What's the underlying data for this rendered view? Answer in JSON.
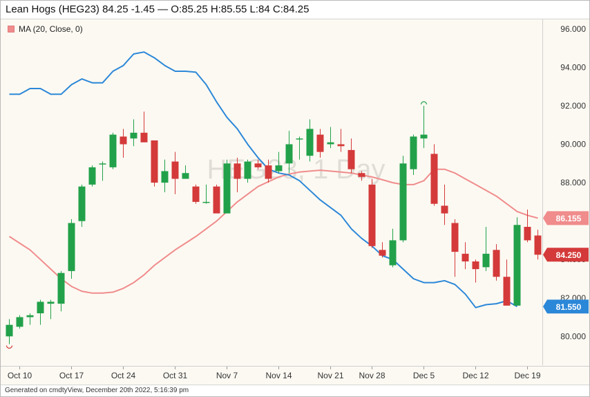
{
  "header": {
    "title": "Lean Hogs (HEG23) 84.25 -1.45 — O:85.25 H:85.55 L:84 C:84.25"
  },
  "footer": {
    "text": "Generated on cmdtyView, December 20th 2022, 5:16:39 pm"
  },
  "legend": {
    "label": "MA (20, Close, 0)"
  },
  "watermark": "HEG23, 1 Day",
  "colors": {
    "up": "#22a14a",
    "down": "#d43a3a",
    "ma": "#f08c8c",
    "band": "#2b87d8",
    "background": "#fcf9f2"
  },
  "chart_data": {
    "type": "candlestick",
    "title": "Lean Hogs (HEG23)",
    "interval": "1 Day",
    "xlabel": "",
    "ylabel": "",
    "ylim": [
      78.5,
      96.5
    ],
    "y_ticks": [
      "80.000",
      "82.000",
      "84.000",
      "86.000",
      "88.000",
      "90.000",
      "92.000",
      "94.000",
      "96.000"
    ],
    "x_tick_labels": [
      "Oct 10",
      "Oct 17",
      "Oct 24",
      "Oct 31",
      "Nov 7",
      "Nov 14",
      "Nov 21",
      "Nov 28",
      "Dec 5",
      "Dec 12",
      "Dec 19"
    ],
    "x_tick_index": [
      1,
      6,
      11,
      16,
      21,
      26,
      31,
      35,
      40,
      45,
      50
    ],
    "candles": [
      {
        "o": 80.0,
        "h": 80.9,
        "l": 79.6,
        "c": 80.6
      },
      {
        "o": 80.5,
        "h": 81.1,
        "l": 80.4,
        "c": 81.0
      },
      {
        "o": 81.0,
        "h": 81.2,
        "l": 80.6,
        "c": 81.1
      },
      {
        "o": 81.2,
        "h": 81.9,
        "l": 80.6,
        "c": 81.8
      },
      {
        "o": 81.7,
        "h": 81.9,
        "l": 80.9,
        "c": 81.8
      },
      {
        "o": 81.7,
        "h": 83.4,
        "l": 81.3,
        "c": 83.3
      },
      {
        "o": 83.4,
        "h": 86.1,
        "l": 83.0,
        "c": 85.9
      },
      {
        "o": 86.0,
        "h": 87.9,
        "l": 85.7,
        "c": 87.8
      },
      {
        "o": 87.9,
        "h": 88.9,
        "l": 87.8,
        "c": 88.8
      },
      {
        "o": 89.0,
        "h": 89.1,
        "l": 88.1,
        "c": 89.0
      },
      {
        "o": 88.8,
        "h": 90.6,
        "l": 88.7,
        "c": 90.5
      },
      {
        "o": 90.4,
        "h": 90.8,
        "l": 89.3,
        "c": 90.0
      },
      {
        "o": 90.3,
        "h": 91.3,
        "l": 89.9,
        "c": 90.6
      },
      {
        "o": 90.6,
        "h": 91.7,
        "l": 90.4,
        "c": 90.1
      },
      {
        "o": 90.2,
        "h": 90.2,
        "l": 87.8,
        "c": 88.0
      },
      {
        "o": 88.0,
        "h": 89.2,
        "l": 87.5,
        "c": 88.6
      },
      {
        "o": 89.1,
        "h": 89.6,
        "l": 87.4,
        "c": 88.2
      },
      {
        "o": 88.2,
        "h": 88.9,
        "l": 88.2,
        "c": 88.5
      },
      {
        "o": 87.8,
        "h": 87.9,
        "l": 86.9,
        "c": 87.0
      },
      {
        "o": 87.0,
        "h": 87.9,
        "l": 86.9,
        "c": 87.0
      },
      {
        "o": 87.8,
        "h": 87.9,
        "l": 86.4,
        "c": 86.4
      },
      {
        "o": 86.4,
        "h": 89.2,
        "l": 86.4,
        "c": 89.0
      },
      {
        "o": 89.0,
        "h": 89.3,
        "l": 87.5,
        "c": 88.2
      },
      {
        "o": 88.2,
        "h": 89.2,
        "l": 88.0,
        "c": 89.1
      },
      {
        "o": 89.0,
        "h": 89.2,
        "l": 88.7,
        "c": 88.8
      },
      {
        "o": 88.9,
        "h": 89.2,
        "l": 88.0,
        "c": 88.2
      },
      {
        "o": 88.6,
        "h": 89.6,
        "l": 88.5,
        "c": 88.9
      },
      {
        "o": 89.0,
        "h": 90.7,
        "l": 88.5,
        "c": 90.0
      },
      {
        "o": 90.3,
        "h": 90.4,
        "l": 89.2,
        "c": 90.3
      },
      {
        "o": 89.4,
        "h": 91.3,
        "l": 89.1,
        "c": 90.8
      },
      {
        "o": 90.5,
        "h": 90.8,
        "l": 89.3,
        "c": 89.6
      },
      {
        "o": 90.0,
        "h": 90.9,
        "l": 89.8,
        "c": 90.1
      },
      {
        "o": 90.0,
        "h": 90.8,
        "l": 89.6,
        "c": 89.9
      },
      {
        "o": 89.7,
        "h": 90.3,
        "l": 88.5,
        "c": 88.7
      },
      {
        "o": 88.5,
        "h": 88.6,
        "l": 88.1,
        "c": 88.3
      },
      {
        "o": 87.9,
        "h": 88.2,
        "l": 84.6,
        "c": 84.7
      },
      {
        "o": 84.5,
        "h": 84.9,
        "l": 84.1,
        "c": 84.2
      },
      {
        "o": 83.7,
        "h": 85.6,
        "l": 83.6,
        "c": 85.0
      },
      {
        "o": 85.0,
        "h": 89.4,
        "l": 84.9,
        "c": 89.0
      },
      {
        "o": 88.7,
        "h": 90.5,
        "l": 88.4,
        "c": 90.4
      },
      {
        "o": 90.3,
        "h": 92.0,
        "l": 89.8,
        "c": 90.5
      },
      {
        "o": 89.5,
        "h": 90.0,
        "l": 86.8,
        "c": 86.9
      },
      {
        "o": 86.8,
        "h": 87.9,
        "l": 85.8,
        "c": 86.4
      },
      {
        "o": 85.9,
        "h": 86.1,
        "l": 83.1,
        "c": 84.4
      },
      {
        "o": 84.3,
        "h": 84.9,
        "l": 83.5,
        "c": 83.9
      },
      {
        "o": 83.9,
        "h": 84.0,
        "l": 82.8,
        "c": 83.5
      },
      {
        "o": 83.6,
        "h": 85.7,
        "l": 83.4,
        "c": 84.3
      },
      {
        "o": 84.5,
        "h": 84.8,
        "l": 82.9,
        "c": 83.1
      },
      {
        "o": 83.1,
        "h": 84.0,
        "l": 81.6,
        "c": 81.6
      },
      {
        "o": 81.6,
        "h": 86.2,
        "l": 81.6,
        "c": 85.8
      },
      {
        "o": 85.7,
        "h": 86.6,
        "l": 84.9,
        "c": 85.0
      },
      {
        "o": 85.25,
        "h": 85.55,
        "l": 84.0,
        "c": 84.25
      }
    ],
    "series": [
      {
        "name": "MA (20, Close, 0)",
        "color": "#f08c8c",
        "values": [
          85.2,
          84.85,
          84.5,
          84.0,
          83.5,
          83.0,
          82.6,
          82.35,
          82.25,
          82.25,
          82.3,
          82.5,
          82.8,
          83.2,
          83.7,
          84.1,
          84.5,
          84.85,
          85.2,
          85.6,
          86.0,
          86.5,
          87.0,
          87.4,
          87.8,
          88.05,
          88.3,
          88.45,
          88.55,
          88.6,
          88.65,
          88.6,
          88.55,
          88.5,
          88.4,
          88.3,
          88.15,
          88.0,
          87.9,
          87.9,
          88.1,
          88.7,
          88.7,
          88.5,
          88.2,
          87.9,
          87.6,
          87.3,
          86.9,
          86.5,
          86.3,
          86.155
        ]
      },
      {
        "name": "Upper band",
        "color": "#2b87d8",
        "values": [
          92.6,
          92.6,
          92.9,
          92.9,
          92.6,
          92.6,
          93.1,
          93.4,
          93.2,
          93.2,
          93.8,
          94.1,
          94.7,
          94.8,
          94.5,
          94.1,
          93.8,
          93.8,
          93.75,
          93.1,
          92.2,
          91.4,
          90.8,
          90.0,
          89.3,
          88.7,
          88.5,
          88.4,
          88.1,
          87.6,
          87.1,
          86.7,
          86.3,
          85.6,
          85.1,
          84.7,
          84.2,
          84.0,
          83.5,
          83.0,
          82.8,
          82.8,
          82.9,
          82.7,
          82.2,
          81.5,
          81.65,
          81.7,
          81.85,
          81.55
        ]
      }
    ],
    "price_labels": [
      {
        "label": "86.155",
        "value": 86.155,
        "color": "#f08c8c"
      },
      {
        "label": "84.250",
        "value": 84.25,
        "color": "#d43a3a"
      },
      {
        "label": "81.550",
        "value": 81.55,
        "color": "#2b87d8"
      }
    ]
  }
}
